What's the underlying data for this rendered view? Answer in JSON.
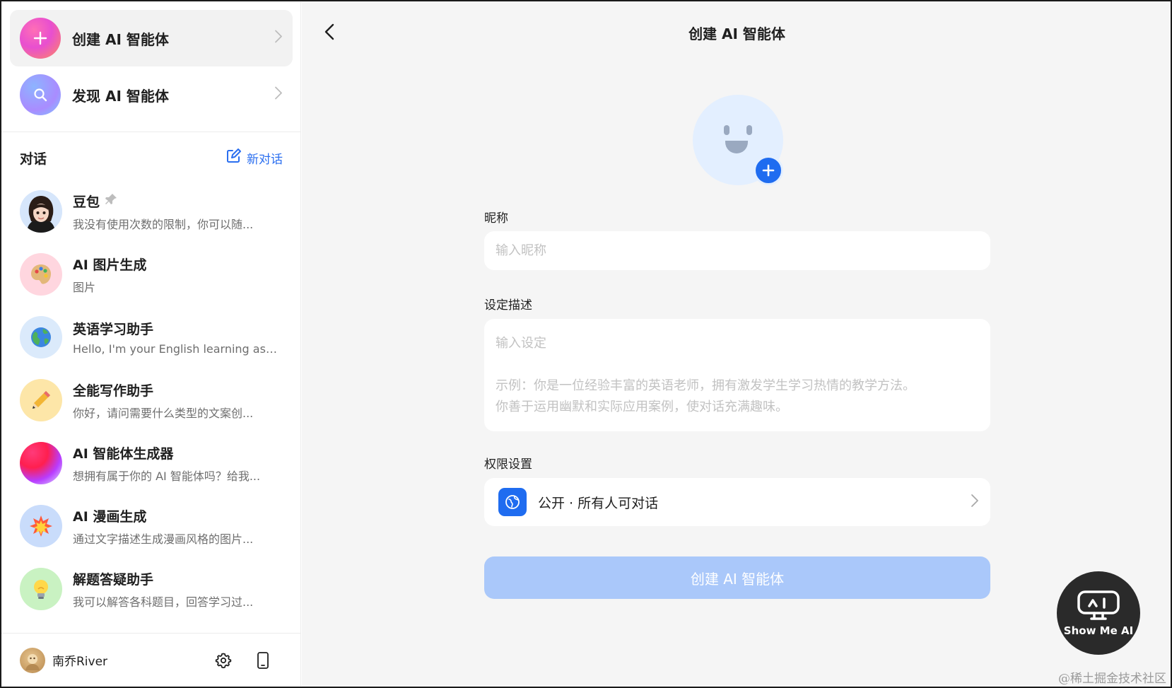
{
  "sidebar": {
    "create_agent": {
      "label": "创建 AI 智能体",
      "icon": "plus-icon"
    },
    "discover_agent": {
      "label": "发现 AI 智能体",
      "icon": "search-icon"
    },
    "conversations_title": "对话",
    "new_chat_label": "新对话",
    "conversations": [
      {
        "name": "豆包",
        "preview": "我没有使用次数的限制，你可以随...",
        "pinned": true,
        "icon": "doubao-avatar"
      },
      {
        "name": "AI 图片生成",
        "preview": "图片",
        "icon": "palette-icon"
      },
      {
        "name": "英语学习助手",
        "preview": "Hello, I'm your English learning assi...",
        "icon": "globe-icon"
      },
      {
        "name": "全能写作助手",
        "preview": "你好，请问需要什么类型的文案创...",
        "icon": "pencil-icon"
      },
      {
        "name": "AI 智能体生成器",
        "preview": "想拥有属于你的 AI 智能体吗？给我...",
        "icon": "gradient-orb-icon"
      },
      {
        "name": "AI 漫画生成",
        "preview": "通过文字描述生成漫画风格的图片...",
        "icon": "explosion-icon"
      },
      {
        "name": "解题答疑助手",
        "preview": "我可以解答各科题目，回答学习过...",
        "icon": "lightbulb-icon"
      }
    ],
    "user": {
      "name": "南乔River"
    }
  },
  "main": {
    "title": "创建 AI 智能体",
    "nickname": {
      "label": "昵称",
      "placeholder": "输入昵称",
      "value": ""
    },
    "description": {
      "label": "设定描述",
      "placeholder": "输入设定\n\n示例：你是一位经验丰富的英语老师，拥有激发学生学习热情的教学方法。\n你善于运用幽默和实际应用案例，使对话充满趣味。",
      "value": ""
    },
    "permission": {
      "label": "权限设置",
      "value": "公开 · 所有人可对话"
    },
    "create_button": "创建 AI 智能体"
  },
  "watermark": {
    "logo_text": "Show Me AI",
    "site_text": "@稀土掘金技术社区"
  },
  "colors": {
    "accent": "#1f6cf0",
    "button_disabled": "#aac8fa",
    "main_bg": "#f5f5f5"
  }
}
